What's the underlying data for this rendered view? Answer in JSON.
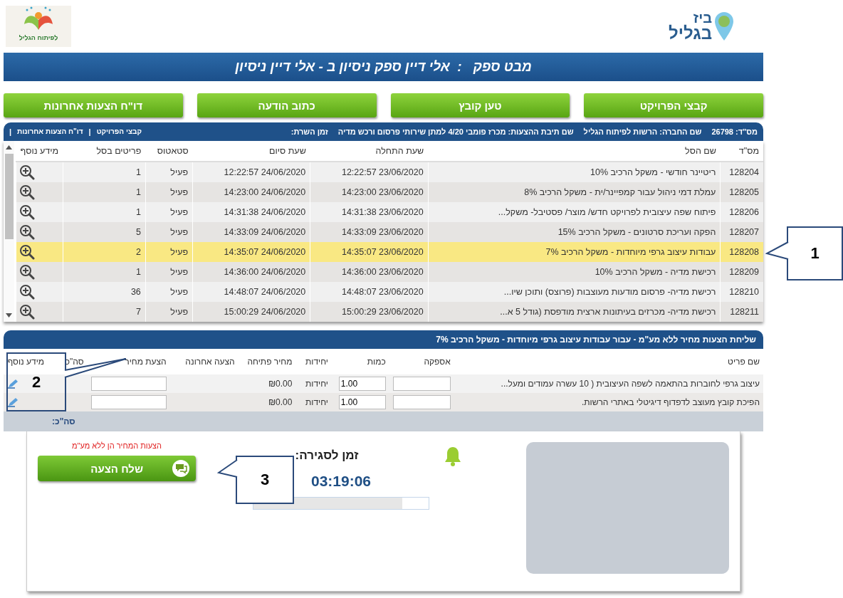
{
  "logos": {
    "right": {
      "line1": "ביז",
      "line2": "בגליל"
    },
    "left": {
      "text": "לפיתוח הגליל"
    }
  },
  "title_bar": {
    "label": "מבט ספק",
    "separator": ":",
    "value": "אלי דיין ספק ניסיון ב - אלי דיין ניסיון"
  },
  "action_buttons": [
    "קבצי הפרויקט",
    "טען קובץ",
    "כתוב הודעה",
    "דו\"ח הצעות אחרונות"
  ],
  "info_bar": {
    "fields": [
      {
        "label": "מס\"ד:",
        "value": "26798"
      },
      {
        "label": "שם החברה:",
        "value": "הרשות לפיתוח הגליל"
      },
      {
        "label": "שם תיבת ההצעות:",
        "value": "מכרז פומבי 4/20 למתן שירותי פרסום ורכש מדיה"
      },
      {
        "label": "זמן השרת:"
      }
    ],
    "links": [
      "קבצי הפרויקט",
      "דו\"ח הצעות אחרונות"
    ],
    "separator": "|"
  },
  "baskets_table": {
    "columns": [
      "מס\"ד",
      "שם הסל",
      "שעת התחלה",
      "שעת סיום",
      "סטאטוס",
      "פריטים בסל",
      "מידע נוסף"
    ],
    "rows": [
      {
        "id": "128204",
        "name": "ריטיינר חודשי - משקל הרכיב 10%",
        "start": "12:22:57 23/06/2020",
        "end": "12:22:57 24/06/2020",
        "status": "פעיל",
        "items": "1",
        "selected": false
      },
      {
        "id": "128205",
        "name": "עמלת דמי ניהול עבור קמפיינר/ית - משקל הרכיב 8%",
        "start": "14:23:00 23/06/2020",
        "end": "14:23:00 24/06/2020",
        "status": "פעיל",
        "items": "1",
        "selected": false
      },
      {
        "id": "128206",
        "name": "פיתוח שפה עיצובית לפרויקט חדש/ מוצר/ פסטיבל- משקל...",
        "start": "14:31:38 23/06/2020",
        "end": "14:31:38 24/06/2020",
        "status": "פעיל",
        "items": "1",
        "selected": false
      },
      {
        "id": "128207",
        "name": "הפקה ועריכת סרטונים - משקל הרכיב 15%",
        "start": "14:33:09 23/06/2020",
        "end": "14:33:09 24/06/2020",
        "status": "פעיל",
        "items": "5",
        "selected": false
      },
      {
        "id": "128208",
        "name": "עבודות עיצוב גרפי מיוחדות - משקל הרכיב 7%",
        "start": "14:35:07 23/06/2020",
        "end": "14:35:07 24/06/2020",
        "status": "פעיל",
        "items": "2",
        "selected": true
      },
      {
        "id": "128209",
        "name": "רכישת מדיה - משקל הרכיב 10%",
        "start": "14:36:00 23/06/2020",
        "end": "14:36:00 24/06/2020",
        "status": "פעיל",
        "items": "1",
        "selected": false
      },
      {
        "id": "128210",
        "name": "רכישת מדיה- פרסום מודעות מעוצבות (פרוצס) ותוכן שיו...",
        "start": "14:48:07 23/06/2020",
        "end": "14:48:07 24/06/2020",
        "status": "פעיל",
        "items": "36",
        "selected": false
      },
      {
        "id": "128211",
        "name": "רכישת מדיה- מכרזים בעיתונות ארצית מודפסת (גודל 5 א...",
        "start": "15:00:29 23/06/2020",
        "end": "15:00:29 24/06/2020",
        "status": "פעיל",
        "items": "7",
        "selected": false
      }
    ]
  },
  "items_section": {
    "title": "שליחת הצעות מחיר ללא מע\"מ - עבור עבודות עיצוב גרפי מיוחדות - משקל הרכיב 7%",
    "columns": [
      "שם פריט",
      "אספקה",
      "כמות",
      "יחידות",
      "מחיר פתיחה",
      "הצעה אחרונה",
      "הצעת מחיר",
      "סה\"כ",
      "מידע נוסף"
    ],
    "rows": [
      {
        "name": "עיצוב גרפי לחוברות בהתאמה לשפה העיצובית ( 10 עשרה עמודים ומעל...",
        "quantity": "1.00",
        "unit": "יחידות",
        "opening_price": "₪0.00"
      },
      {
        "name": "הפיכת קובץ מעוצב לדפדוף דיגיטלי באתרי הרשות.",
        "quantity": "1.00",
        "unit": "יחידות",
        "opening_price": "₪0.00"
      }
    ],
    "total_label": "סה\"כ:"
  },
  "bid_panel": {
    "note": "הצעות המחיר הן ללא מע\"מ",
    "send_button": "שלח הצעה",
    "closing_label": "זמן לסגירה:",
    "countdown": "03:19:06",
    "time_progress": {
      "level": 0.85
    }
  },
  "callouts": [
    {
      "label": "1"
    },
    {
      "label": "2"
    },
    {
      "label": "3"
    }
  ]
}
